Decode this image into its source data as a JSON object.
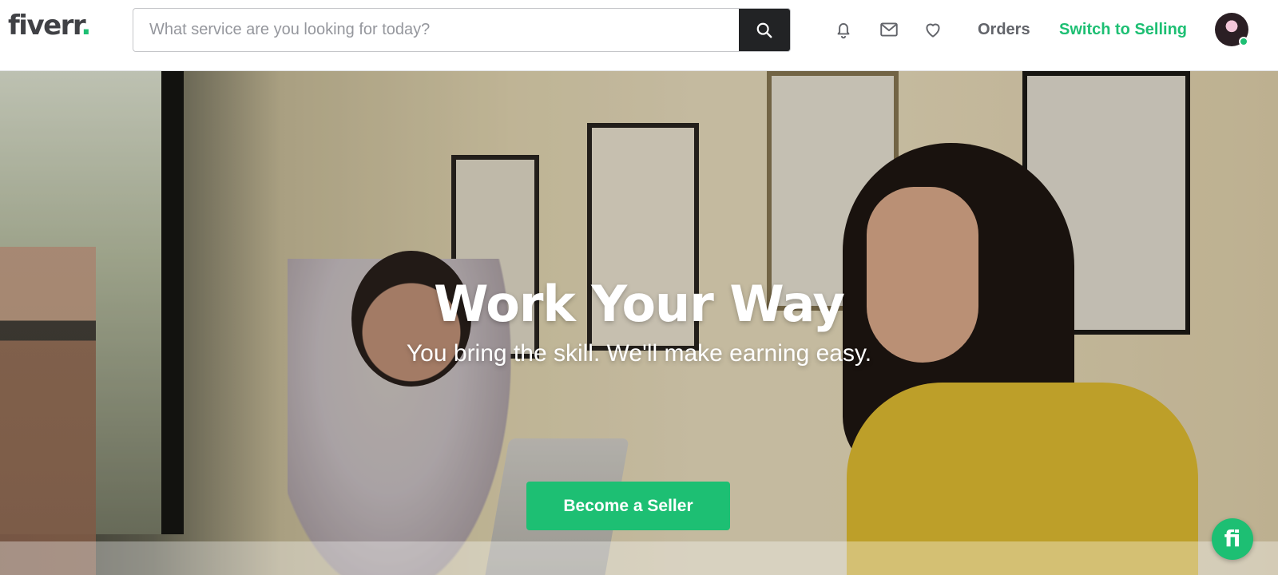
{
  "brand": {
    "logo_text": "fiverr",
    "logo_dot": ".",
    "accent": "#1dbf73"
  },
  "header": {
    "search": {
      "placeholder": "What service are you looking for today?"
    },
    "icons": [
      "bell-icon",
      "mail-icon",
      "heart-icon",
      "search-icon"
    ],
    "orders_label": "Orders",
    "switch_label": "Switch to Selling",
    "avatar_status": "online"
  },
  "hero": {
    "title": "Work Your Way",
    "subtitle": "You bring the skill. We'll make earning easy.",
    "cta_label": "Become a Seller"
  },
  "chat": {
    "label": "fi"
  }
}
